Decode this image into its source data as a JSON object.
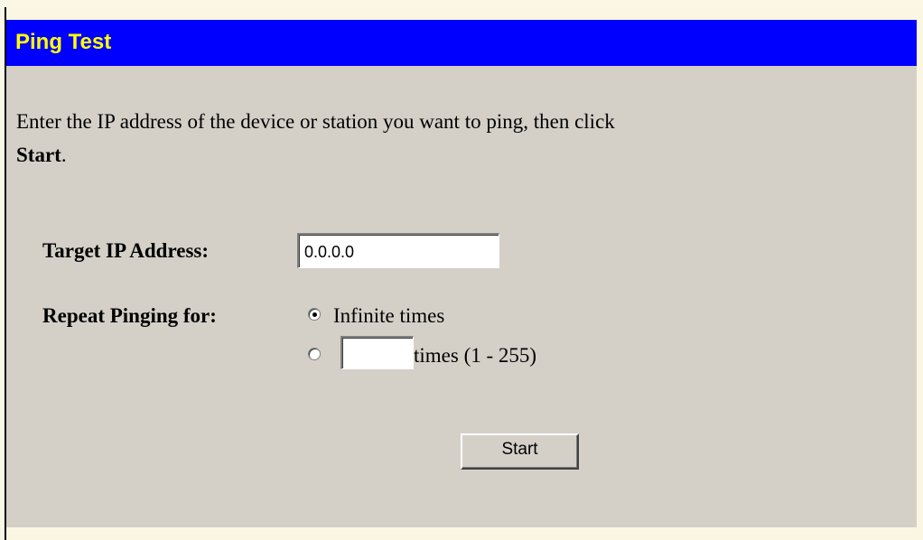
{
  "title": "Ping Test",
  "instructions": {
    "text": "Enter the IP address of the device or station you want to ping, then click",
    "emphasis": "Start",
    "suffix": "."
  },
  "target_ip": {
    "label": "Target IP Address:",
    "value": "0.0.0.0"
  },
  "repeat": {
    "label": "Repeat Pinging for:",
    "option_infinite": "Infinite times",
    "option_count_suffix": "times (1 - 255)",
    "count_value": "",
    "selected": "infinite"
  },
  "start_button": "Start",
  "colors": {
    "title_bg": "#0000ff",
    "title_fg": "#ffff00",
    "panel_bg": "#d4d0c8"
  }
}
